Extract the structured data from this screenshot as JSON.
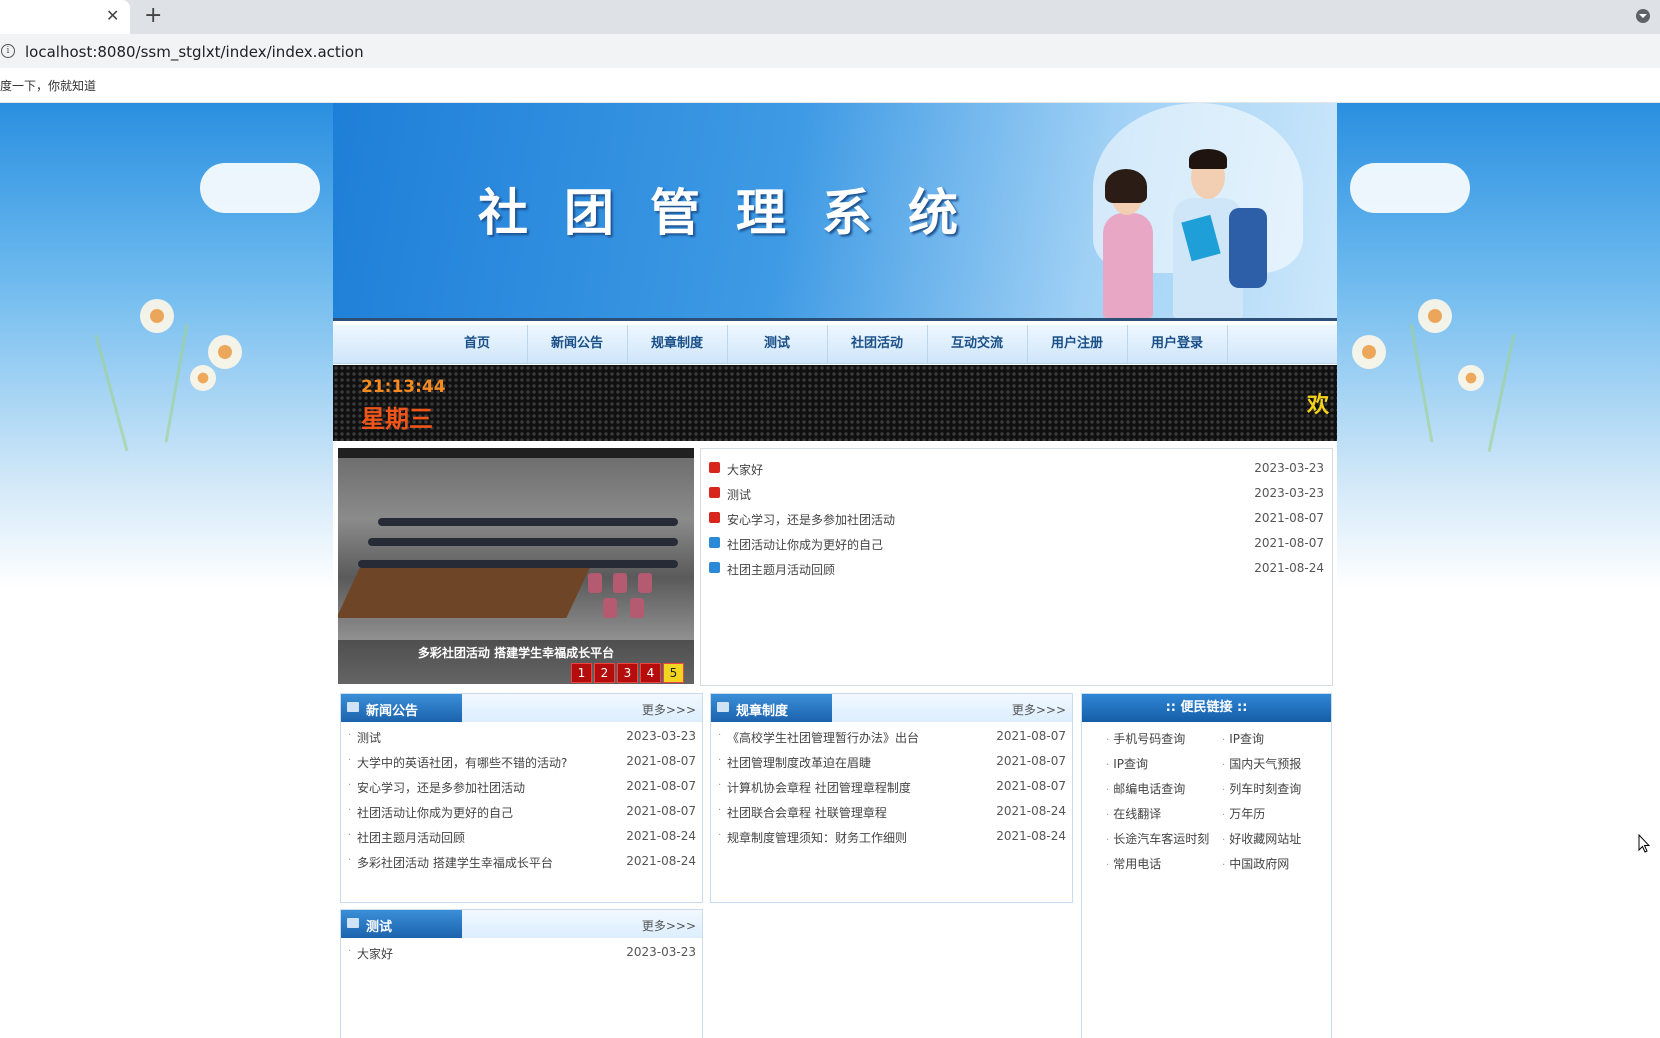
{
  "browser": {
    "url": "localhost:8080/ssm_stglxt/index/index.action",
    "bookmark": "度一下，你就知道"
  },
  "header": {
    "site_title": "社团管理系统"
  },
  "nav": [
    "首页",
    "新闻公告",
    "规章制度",
    "测试",
    "社团活动",
    "互动交流",
    "用户注册",
    "用户登录"
  ],
  "ticker": {
    "time": "21:13:44",
    "weekday": "星期三",
    "scroll_text": "欢"
  },
  "slideshow": {
    "caption": "多彩社团活动 搭建学生幸福成长平台",
    "pages": [
      "1",
      "2",
      "3",
      "4",
      "5"
    ],
    "active_page": 5
  },
  "top_news": [
    {
      "title": "大家好",
      "date": "2023-03-23",
      "icon_color": "#d9261c"
    },
    {
      "title": "测试",
      "date": "2023-03-23",
      "icon_color": "#d9261c"
    },
    {
      "title": "安心学习，还是多参加社团活动",
      "date": "2021-08-07",
      "icon_color": "#d9261c"
    },
    {
      "title": "社团活动让你成为更好的自己",
      "date": "2021-08-07",
      "icon_color": "#2a8ad8"
    },
    {
      "title": "社团主题月活动回顾",
      "date": "2021-08-24",
      "icon_color": "#2a8ad8"
    }
  ],
  "panels": {
    "news": {
      "title": "新闻公告",
      "more": "更多>>>",
      "items": [
        {
          "title": "测试",
          "date": "2023-03-23"
        },
        {
          "title": "大学中的英语社团，有哪些不错的活动?",
          "date": "2021-08-07"
        },
        {
          "title": "安心学习，还是多参加社团活动",
          "date": "2021-08-07"
        },
        {
          "title": "社团活动让你成为更好的自己",
          "date": "2021-08-07"
        },
        {
          "title": "社团主题月活动回顾",
          "date": "2021-08-24"
        },
        {
          "title": "多彩社团活动 搭建学生幸福成长平台",
          "date": "2021-08-24"
        }
      ]
    },
    "rules": {
      "title": "规章制度",
      "more": "更多>>>",
      "items": [
        {
          "title": "《高校学生社团管理暂行办法》出台",
          "date": "2021-08-07"
        },
        {
          "title": "社团管理制度改革迫在眉睫",
          "date": "2021-08-07"
        },
        {
          "title": "计算机协会章程 社团管理章程制度",
          "date": "2021-08-07"
        },
        {
          "title": "社团联合会章程 社联管理章程",
          "date": "2021-08-24"
        },
        {
          "title": "规章制度管理须知：财务工作细则",
          "date": "2021-08-24"
        }
      ]
    },
    "test": {
      "title": "测试",
      "more": "更多>>>",
      "items": [
        {
          "title": "大家好",
          "date": "2023-03-23"
        }
      ]
    },
    "links": {
      "title": ":: 便民链接 ::",
      "items": [
        "手机号码查询",
        "IP查询",
        "IP查询",
        "国内天气预报",
        "邮编电话查询",
        "列车时刻查询",
        "在线翻译",
        "万年历",
        "长途汽车客运时刻",
        "好收藏网站址",
        "常用电话",
        "中国政府网"
      ]
    }
  }
}
